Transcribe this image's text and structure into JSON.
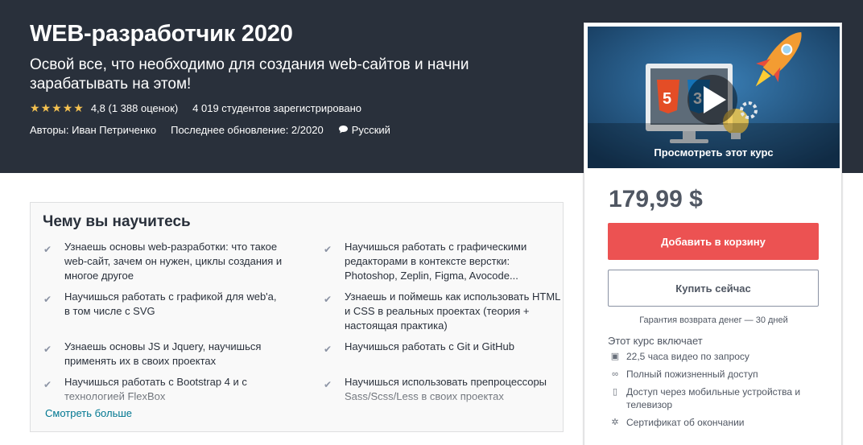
{
  "course": {
    "title": "WEB-разработчик 2020",
    "subtitle": "Освой все, что необходимо для создания web-сайтов и начни зарабатывать на этом!",
    "rating": 4.8,
    "rating_text": "4,8 (1 388 оценок)",
    "students": "4 019 студентов зарегистрировано",
    "authors": "Авторы: Иван Петриченко",
    "updated": "Последнее обновление: 2/2020",
    "language": "Русский",
    "star_color": "#f4c150",
    "stars": 5
  },
  "learn": {
    "title": "Чему вы научитесь",
    "left_items": [
      "Узнаешь основы web-разработки: что такое web-сайт, зачем он нужен, циклы создания и многое другое",
      "Научишься работать с графикой для web'а, в том числе с SVG",
      "Узнаешь основы JS и Jquery, научишься применять их в своих проектах",
      "Научишься работать с Bootstrap 4 и с технологией FlexBox"
    ],
    "right_items": [
      "Научишься работать с графическими редакторами в контексте верстки: Photoshop, Zeplin, Figma, Avocode...",
      "Узнаешь и поймешь как использовать HTML и CSS в реальных проектах (теория + настоящая практика)",
      "Научишься работать с Git и GitHub",
      "Научишься использовать препроцессоры Sass/Scss/Less в своих проектах"
    ],
    "see_more": "Смотреть больше",
    "check_icon": "check-icon"
  },
  "sidebar": {
    "preview_label": "Просмотреть этот курс",
    "price": "179,99 $",
    "add_to_cart": "Добавить в корзину",
    "buy_now": "Купить сейчас",
    "guarantee": "Гарантия возврата денег — 30 дней",
    "includes_title": "Этот курс включает",
    "includes": [
      {
        "icon": "video-icon",
        "glyph": "▣",
        "text": "22,5 часа видео по запросу"
      },
      {
        "icon": "infinity-icon",
        "glyph": "∞",
        "text": "Полный пожизненный доступ"
      },
      {
        "icon": "mobile-icon",
        "glyph": "▯",
        "text": "Доступ через мобильные устройства и телевизор"
      },
      {
        "icon": "certificate-icon",
        "glyph": "✲",
        "text": "Сертификат об окончании"
      }
    ],
    "accent_color": "#ec5252"
  }
}
